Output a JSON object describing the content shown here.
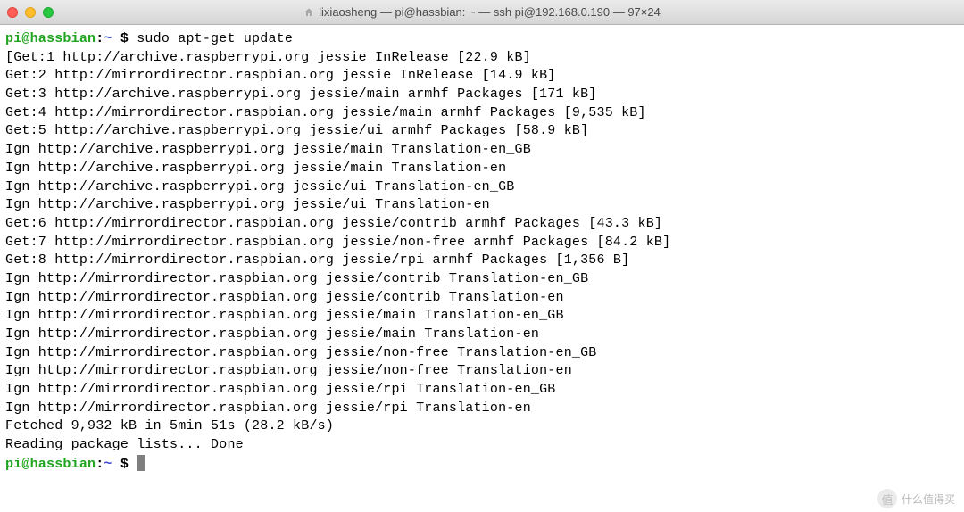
{
  "window": {
    "title": "lixiaosheng — pi@hassbian: ~ — ssh pi@192.168.0.190 — 97×24"
  },
  "prompt": {
    "user_host": "pi@hassbian",
    "sep1": ":",
    "path": "~ ",
    "dollar": "$"
  },
  "command": "sudo apt-get update",
  "output": [
    "Get:1 http://archive.raspberrypi.org jessie InRelease [22.9 kB]",
    "Get:2 http://mirrordirector.raspbian.org jessie InRelease [14.9 kB]",
    "Get:3 http://archive.raspberrypi.org jessie/main armhf Packages [171 kB]",
    "Get:4 http://mirrordirector.raspbian.org jessie/main armhf Packages [9,535 kB]",
    "Get:5 http://archive.raspberrypi.org jessie/ui armhf Packages [58.9 kB]",
    "Ign http://archive.raspberrypi.org jessie/main Translation-en_GB",
    "Ign http://archive.raspberrypi.org jessie/main Translation-en",
    "Ign http://archive.raspberrypi.org jessie/ui Translation-en_GB",
    "Ign http://archive.raspberrypi.org jessie/ui Translation-en",
    "Get:6 http://mirrordirector.raspbian.org jessie/contrib armhf Packages [43.3 kB]",
    "Get:7 http://mirrordirector.raspbian.org jessie/non-free armhf Packages [84.2 kB]",
    "Get:8 http://mirrordirector.raspbian.org jessie/rpi armhf Packages [1,356 B]",
    "Ign http://mirrordirector.raspbian.org jessie/contrib Translation-en_GB",
    "Ign http://mirrordirector.raspbian.org jessie/contrib Translation-en",
    "Ign http://mirrordirector.raspbian.org jessie/main Translation-en_GB",
    "Ign http://mirrordirector.raspbian.org jessie/main Translation-en",
    "Ign http://mirrordirector.raspbian.org jessie/non-free Translation-en_GB",
    "Ign http://mirrordirector.raspbian.org jessie/non-free Translation-en",
    "Ign http://mirrordirector.raspbian.org jessie/rpi Translation-en_GB",
    "Ign http://mirrordirector.raspbian.org jessie/rpi Translation-en",
    "Fetched 9,932 kB in 5min 51s (28.2 kB/s)",
    "Reading package lists... Done"
  ],
  "watermark": {
    "icon_text": "值",
    "text": "什么值得买"
  }
}
